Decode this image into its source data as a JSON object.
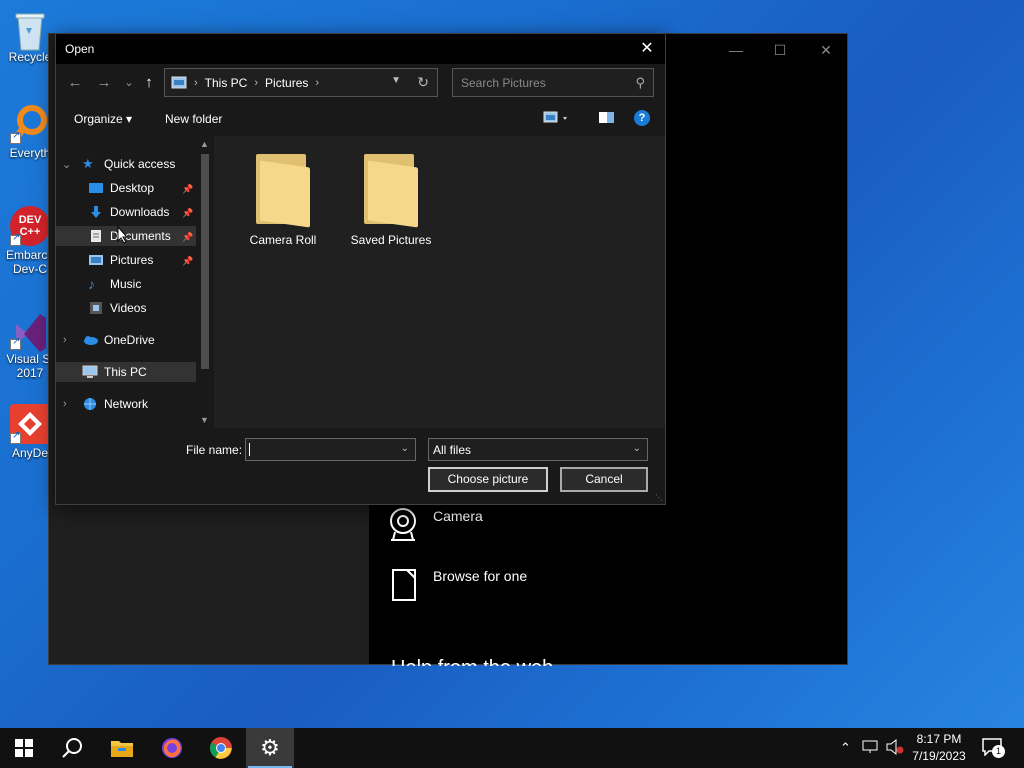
{
  "desktop": {
    "icons": [
      {
        "name": "recycle-bin-icon",
        "label": "Recycle"
      },
      {
        "name": "everything-icon",
        "label": "Everyth"
      },
      {
        "name": "embarcadero-devcpp-icon",
        "label1": "Embarca",
        "label2": "Dev-C",
        "logo": "DEV C++"
      },
      {
        "name": "visual-studio-icon",
        "label1": "Visual St",
        "label2": "2017"
      },
      {
        "name": "anydesk-icon",
        "label": "AnyDe"
      }
    ]
  },
  "settings_window": {
    "options": [
      {
        "label": "Camera",
        "icon": "camera-icon"
      },
      {
        "label": "Browse for one",
        "icon": "document-icon"
      }
    ],
    "cut_text": "Help from the web",
    "controls": {
      "minimize": "—",
      "maximize": "☐",
      "close": "✕"
    }
  },
  "open_dialog": {
    "title": "Open",
    "close_glyph": "✕",
    "nav": {
      "back": "←",
      "forward": "→",
      "recent": "⌄",
      "up": "↑"
    },
    "address": {
      "crumbs": [
        "This PC",
        "Pictures"
      ],
      "sep": "›"
    },
    "search_placeholder": "Search Pictures",
    "commands": {
      "organize": "Organize ▾",
      "new_folder": "New folder",
      "help": "?"
    },
    "tree": {
      "quick_access": "Quick access",
      "desktop": "Desktop",
      "downloads": "Downloads",
      "documents": "Documents",
      "pictures": "Pictures",
      "music": "Music",
      "videos": "Videos",
      "onedrive": "OneDrive",
      "this_pc": "This PC",
      "network": "Network"
    },
    "folders": [
      "Camera Roll",
      "Saved Pictures"
    ],
    "file_name_label": "File name:",
    "file_name_value": "",
    "file_type": "All files",
    "primary_button": "Choose picture",
    "cancel_button": "Cancel"
  },
  "taskbar": {
    "time": "8:17 PM",
    "date": "7/19/2023",
    "notification_count": "1",
    "apps": [
      "start-button",
      "search-button",
      "file-explorer",
      "firefox",
      "chrome",
      "settings"
    ]
  },
  "colors": {
    "accent": "#1c7ad8",
    "folder": "#f5d88a",
    "dialog_bg": "#202020",
    "taskbar_bg": "#111111"
  }
}
